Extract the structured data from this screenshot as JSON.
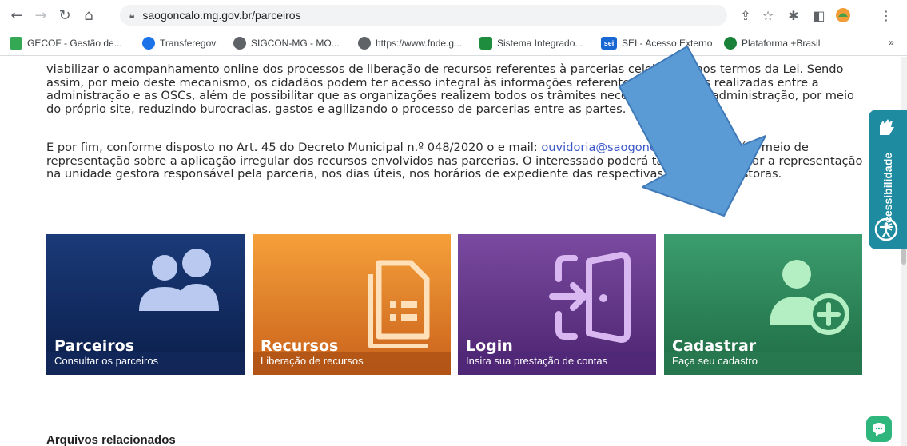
{
  "browser": {
    "url": "saogoncalo.mg.gov.br/parceiros",
    "bookmarks": [
      {
        "label": "GECOF - Gestão de...",
        "color": "#34a853"
      },
      {
        "label": "Transferegov",
        "color": "#1a73e8"
      },
      {
        "label": "SIGCON-MG - MO...",
        "color": "#5f6368"
      },
      {
        "label": "https://www.fnde.g...",
        "color": "#5f6368"
      },
      {
        "label": "Sistema Integrado...",
        "color": "#1e8e3e"
      },
      {
        "label": "SEI - Acesso Externo",
        "color": "#1967d2"
      },
      {
        "label": "Plataforma +Brasil",
        "color": "#188038"
      }
    ],
    "more_bookmarks": "»",
    "sei_badge": "sei"
  },
  "content": {
    "para1": "viabilizar o acompanhamento online dos processos de liberação de recursos referentes à parcerias celebradas nos termos da Lei. Sendo assim, por meio deste mecanismo, os cidadãos podem ter acesso integral às informações referentes às parcerias realizadas entre a administração e as OSCs, além de possibilitar que as organizações realizem todos os trâmites necessários com a administração, por meio do próprio site, reduzindo burocracias, gastos e agilizando o processo de parcerias entre as partes.",
    "para2_before": "E por fim, conforme disposto no Art. 45 do Decreto Municipal n.º 048/2020 o e mail: ",
    "para2_link": "ouvidoria@saogoncalo.mg.gov.br",
    "para2_after": " é o meio de representação sobre a aplicação irregular dos recursos envolvidos nas parcerias. O interessado poderá também protocolar a representação na unidade gestora responsável pela parceria, nos dias úteis, nos horários de expediente das respectivas, unidades gestoras.",
    "section_title": "Arquivos relacionados"
  },
  "cards": [
    {
      "title": "Parceiros",
      "subtitle": "Consultar os parceiros",
      "icon": "users-icon",
      "color_top": "#1a3a78",
      "color_bottom": "#0b1e4a"
    },
    {
      "title": "Recursos",
      "subtitle": "Liberação de recursos",
      "icon": "document-list-icon",
      "color_top": "#f5a03a",
      "color_bottom": "#c9611b"
    },
    {
      "title": "Login",
      "subtitle": "Insira sua prestação de contas",
      "icon": "login-door-icon",
      "color_top": "#7a4aa0",
      "color_bottom": "#4c2470"
    },
    {
      "title": "Cadastrar",
      "subtitle": "Faça seu cadastro",
      "icon": "add-user-icon",
      "color_top": "#3b9d6e",
      "color_bottom": "#1f6b44"
    }
  ],
  "accessibility": {
    "label": "Acessibilidade",
    "color": "#1e8ba0"
  },
  "chat": {
    "icon": "chat-icon",
    "color": "#2fb67c"
  },
  "overlay": {
    "icon": "arrow-annotation-icon",
    "color": "#5b9bd5"
  }
}
